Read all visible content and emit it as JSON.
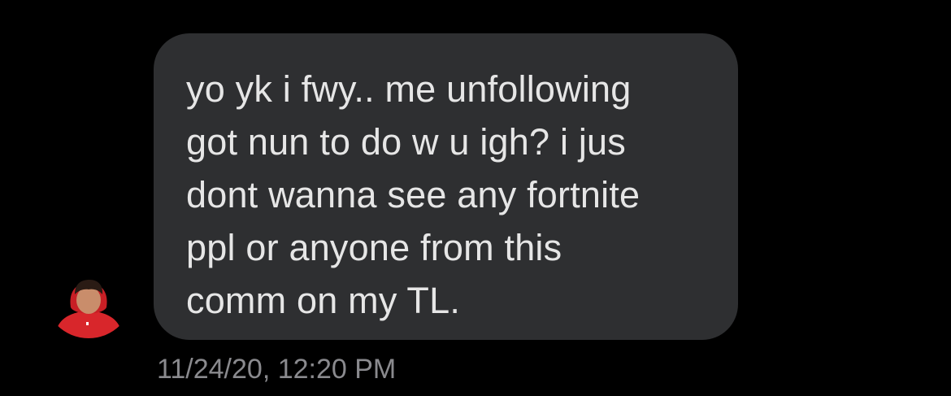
{
  "conversation": {
    "message": {
      "lines": [
        "yo yk i fwy.. me unfollowing",
        "got nun to do w u igh? i jus",
        "dont wanna see any fortnite",
        "ppl or anyone from this",
        "comm on my TL."
      ],
      "timestamp": "11/24/20, 12:20 PM",
      "bubble_color": "#2e2f31",
      "text_color": "#e6e6e6"
    },
    "sender": {
      "avatar_icon": "user-avatar"
    }
  },
  "theme": {
    "background": "#000000",
    "timestamp_color": "#8a8a8e"
  }
}
